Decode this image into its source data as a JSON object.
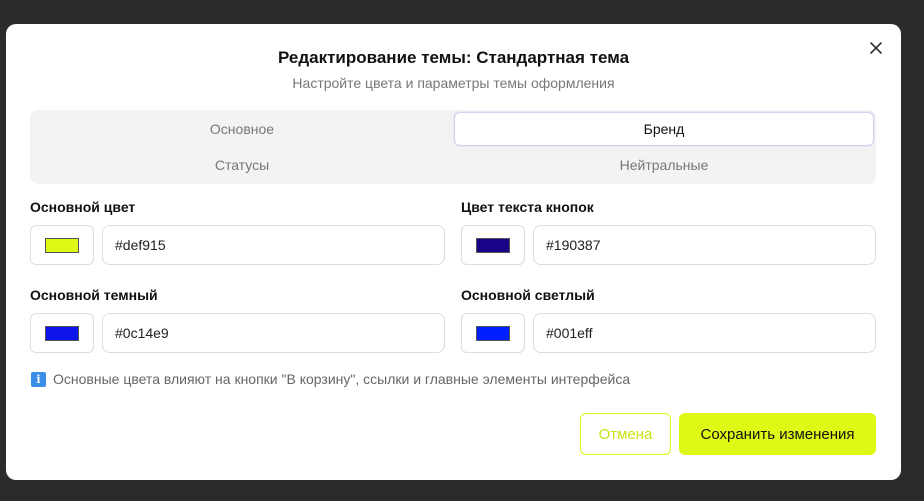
{
  "dialog": {
    "title": "Редактирование темы: Стандартная тема",
    "subtitle": "Настройте цвета и параметры темы оформления",
    "close_icon": "close-icon"
  },
  "tabs": [
    {
      "label": "Основное",
      "active": false
    },
    {
      "label": "Бренд",
      "active": true
    },
    {
      "label": "Статусы",
      "active": false
    },
    {
      "label": "Нейтральные",
      "active": false
    }
  ],
  "fields": {
    "primary": {
      "label": "Основной цвет",
      "value": "#def915",
      "color": "#def915"
    },
    "button_text": {
      "label": "Цвет текста кнопок",
      "value": "#190387",
      "color": "#190387"
    },
    "primary_dark": {
      "label": "Основной темный",
      "value": "#0c14e9",
      "color": "#0c14e9"
    },
    "primary_light": {
      "label": "Основной светлый",
      "value": "#001eff",
      "color": "#001eff"
    }
  },
  "info": {
    "icon": "info-icon",
    "text": "Основные цвета влияют на кнопки \"В корзину\", ссылки и главные элементы интерфейса"
  },
  "actions": {
    "cancel_label": "Отмена",
    "save_label": "Сохранить изменения"
  },
  "colors": {
    "accent": "#def915",
    "backdrop": "#2b2b2b"
  }
}
